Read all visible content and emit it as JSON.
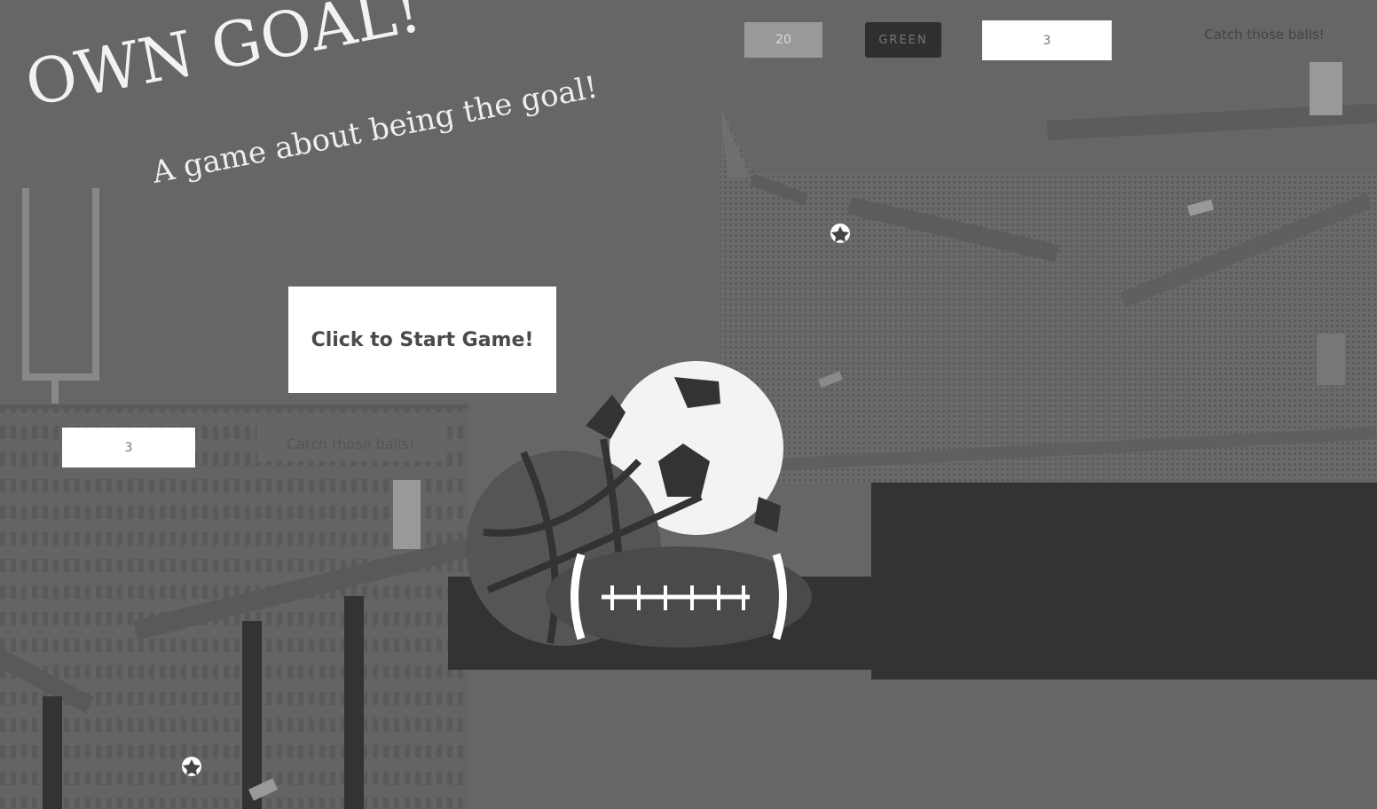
{
  "title": {
    "main": "OWN GOAL!",
    "subtitle": "A game about being the goal!"
  },
  "start_button": {
    "label": "Click to Start Game!"
  },
  "right_panel": {
    "score": "20",
    "team": "GREEN",
    "lives": "3",
    "hint": "Catch those balls!"
  },
  "left_panel": {
    "lives": "3",
    "hint": "Catch those balls!"
  },
  "colors": {
    "background": "#666666",
    "dark": "#333333",
    "panel": "#999999"
  },
  "icons": [
    "goalpost-icon",
    "soccer-ball-icon",
    "basketball-icon",
    "football-icon",
    "star-icon"
  ]
}
